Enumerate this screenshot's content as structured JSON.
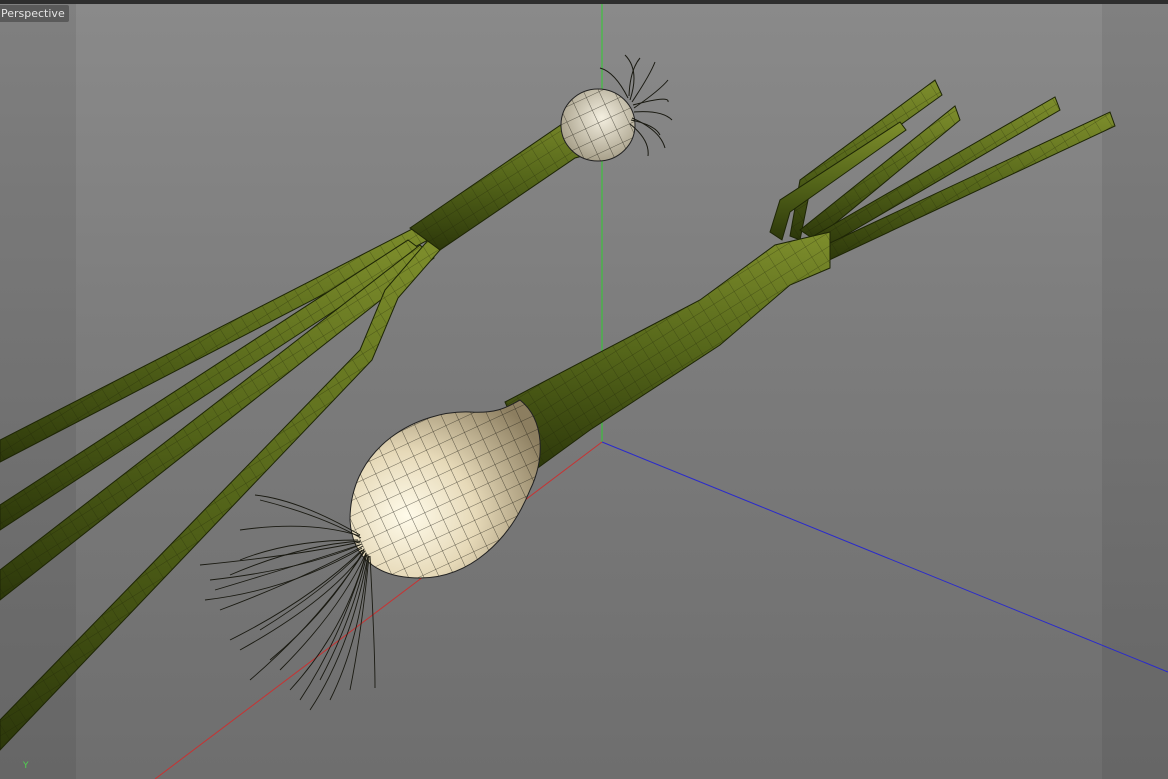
{
  "viewport": {
    "view_name": "Perspective",
    "axis_indicator": "Y"
  },
  "scene": {
    "objects": [
      "spring-onion-near",
      "spring-onion-far"
    ],
    "colors": {
      "stalk": "#5d6e1e",
      "stalk_dark": "#2f3a0c",
      "bulb": "#e8dcc0",
      "bulb_shadow": "#9a8c6c",
      "wire": "#1a1a12",
      "axis_x": "#c83232",
      "axis_y": "#2fcf2f",
      "axis_z": "#2a2acc"
    }
  }
}
